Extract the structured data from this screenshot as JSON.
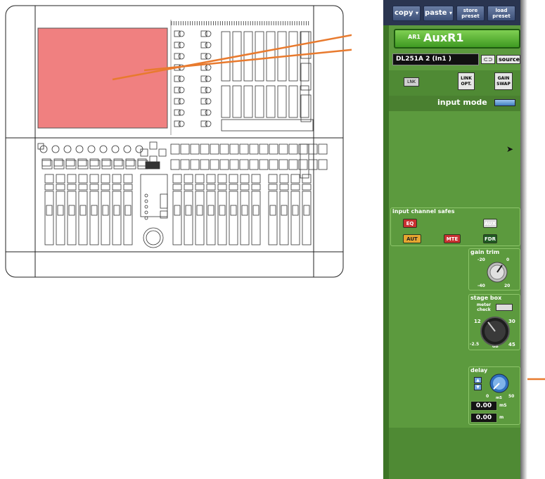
{
  "toolbar": {
    "copy": "copy",
    "paste": "paste",
    "store_preset": "store preset",
    "load_preset": "load preset"
  },
  "channel": {
    "id": "AR1",
    "name": "AuxR1",
    "input_source": "DL251A 2  (In1 )",
    "source_button": "source"
  },
  "buttons": {
    "link_opt": "LINK OPT.",
    "gain_swap": "GAIN SWAP",
    "input_mode": "input mode"
  },
  "safes": {
    "title": "input channel safes",
    "eq": "EQ",
    "aux": "AUX",
    "aut": "AUT",
    "mte": "MTE",
    "fdr": "FDR"
  },
  "gain_trim": {
    "title": "gain trim",
    "tick_tl": "-20",
    "tick_tr": "0",
    "tick_bl": "-40",
    "tick_br": "20"
  },
  "stage_box": {
    "title": "stage box",
    "meter_check": "meter check",
    "tick_12": "12",
    "tick_30": "30",
    "tick_low": "-2.5",
    "tick_unit": "dB",
    "tick_45": "45"
  },
  "delay": {
    "title": "delay",
    "tick_0": "0",
    "tick_unit": "mS",
    "tick_50": "50",
    "ms_value": "0.00",
    "ms_unit": "mS",
    "m_value": "0.00",
    "m_unit": "m"
  },
  "colors": {
    "panel_green": "#5c9a3e",
    "highlight_red": "#f08080",
    "callout_orange": "#e87a2e"
  },
  "icons": {
    "cursor": "mouse-pointer-icon"
  }
}
